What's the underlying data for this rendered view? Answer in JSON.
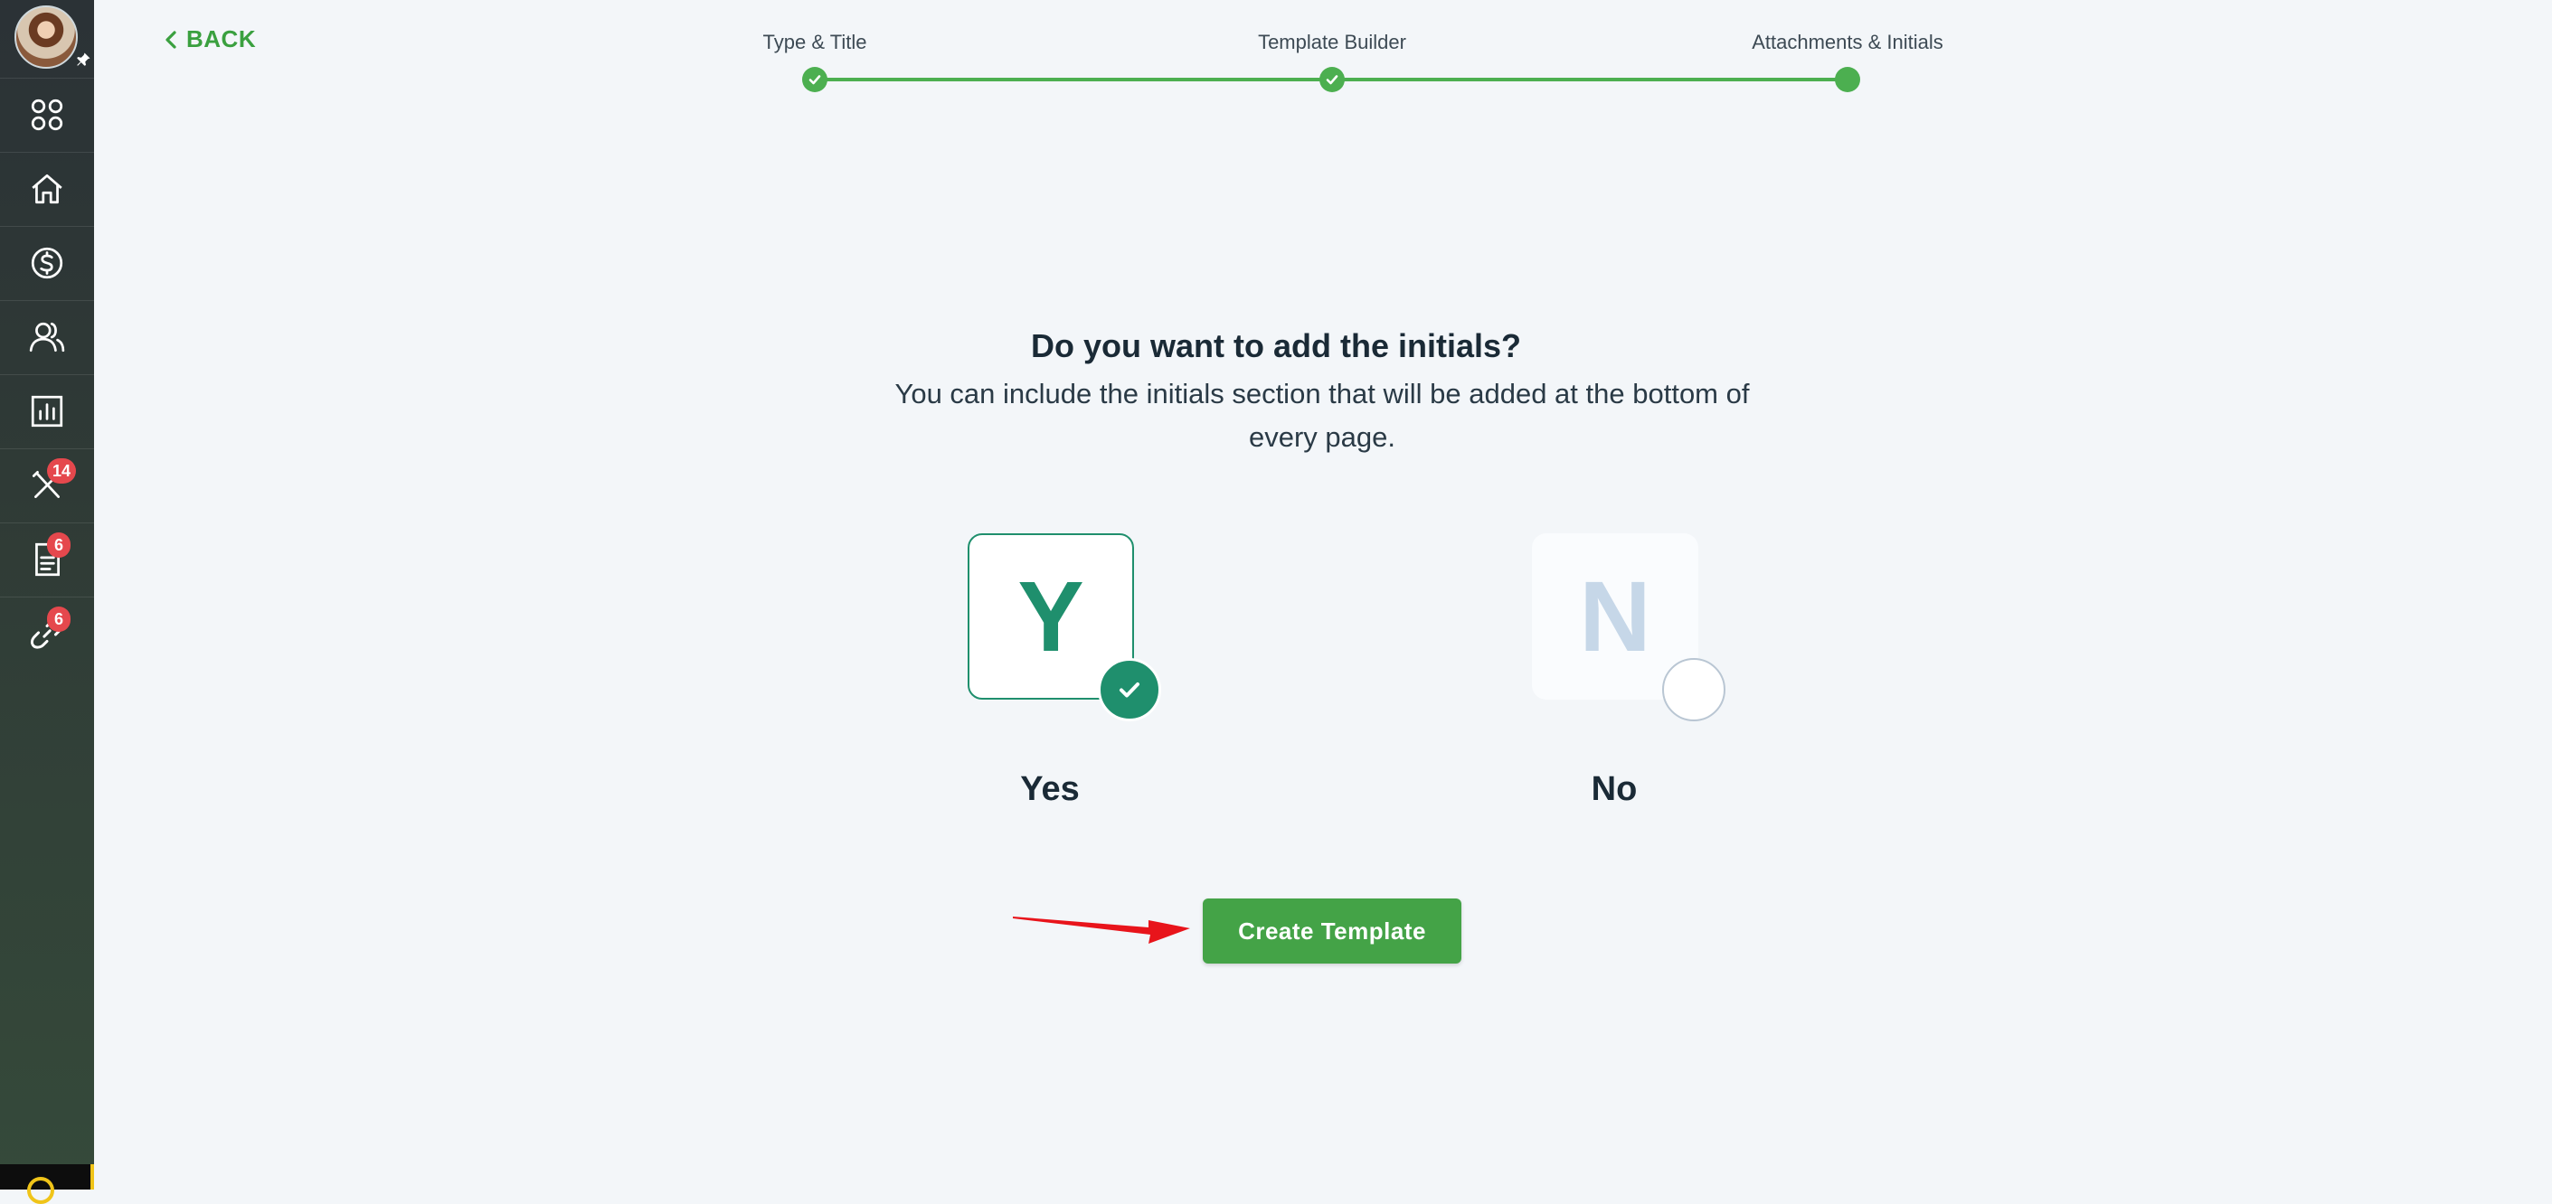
{
  "sidebar": {
    "items": [
      {
        "name": "apps-grid-icon",
        "badge": ""
      },
      {
        "name": "home-icon",
        "badge": ""
      },
      {
        "name": "dollar-icon",
        "badge": ""
      },
      {
        "name": "users-icon",
        "badge": ""
      },
      {
        "name": "chart-icon",
        "badge": ""
      },
      {
        "name": "tools-icon",
        "badge": "14"
      },
      {
        "name": "document-icon",
        "badge": "6"
      },
      {
        "name": "link-icon",
        "badge": "6"
      }
    ]
  },
  "nav": {
    "back_label": "BACK"
  },
  "stepper": {
    "steps": [
      {
        "label": "Type & Title",
        "status": "complete"
      },
      {
        "label": "Template Builder",
        "status": "complete"
      },
      {
        "label": "Attachments & Initials",
        "status": "current"
      }
    ],
    "color": "#4caf50"
  },
  "question": {
    "title": "Do you want to add the initials?",
    "subtitle": "You can include the initials section that will be added at the bottom of every page."
  },
  "options": {
    "yes": {
      "letter": "Y",
      "label": "Yes",
      "selected": true
    },
    "no": {
      "letter": "N",
      "label": "No",
      "selected": false
    }
  },
  "actions": {
    "create_label": "Create Template"
  },
  "colors": {
    "accent": "#44a347",
    "selected": "#1f8f6d",
    "badge": "#e5484d"
  }
}
